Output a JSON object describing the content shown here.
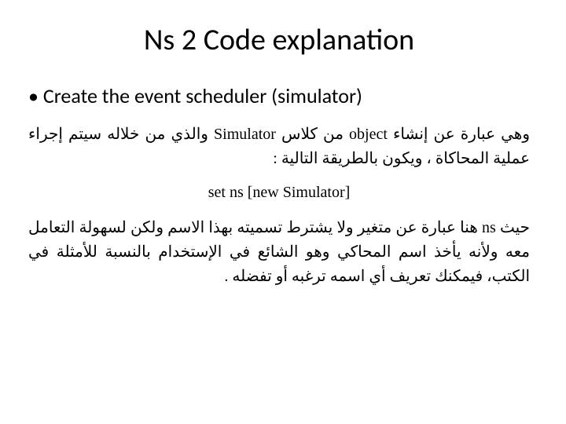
{
  "title": "Ns 2 Code explanation",
  "bullet1": "Create the event scheduler (simulator)",
  "para1_part1": "وهي عبارة عن إنشاء ",
  "para1_obj": "object",
  "para1_part2": " من كلاس ",
  "para1_sim": "Simulator",
  "para1_part3": " والذي من خلاله سيتم إجراء عملية المحاكاة ، ويكون بالطريقة التالية :",
  "code": "set ns [new Simulator]",
  "para2_part1": "حيث ",
  "para2_ns": "ns",
  "para2_part2": " هنا عبارة عن متغير ولا يشترط تسميته بهذا الاسم ولكن لسهولة التعامل معه ولأنه يأخذ اسم المحاكي وهو الشائع في الإستخدام بالنسبة للأمثلة في الكتب، فيمكنك تعريف أي اسمه ترغبه أو تفضله ."
}
